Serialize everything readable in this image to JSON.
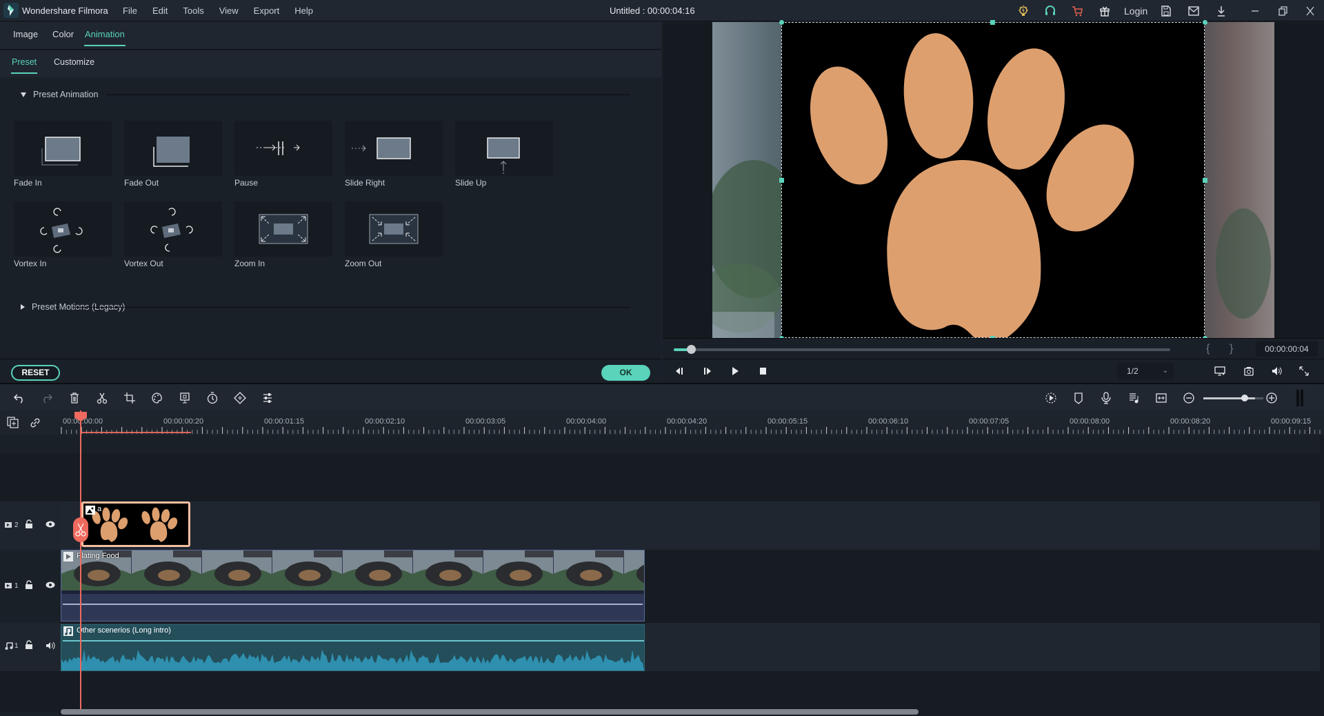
{
  "titlebar": {
    "app_name": "Wondershare Filmora",
    "menu": [
      "File",
      "Edit",
      "Tools",
      "View",
      "Export",
      "Help"
    ],
    "document_title": "Untitled : 00:00:04:16",
    "login_label": "Login",
    "icons": [
      "tips-bulb-icon",
      "support-headset-icon",
      "cart-icon",
      "gift-icon",
      "save-icon",
      "mail-icon",
      "download-icon",
      "minimize-icon",
      "restore-icon",
      "close-icon"
    ]
  },
  "editor": {
    "tabs": [
      "Image",
      "Color",
      "Animation"
    ],
    "active_tab": "Animation",
    "subtabs": [
      "Preset",
      "Customize"
    ],
    "active_subtab": "Preset",
    "section_preset_animation": "Preset Animation",
    "section_preset_motions": "Preset Motions (Legacy)",
    "presets": [
      {
        "label": "Fade In",
        "icon": "fade-in-icon"
      },
      {
        "label": "Fade Out",
        "icon": "fade-out-icon"
      },
      {
        "label": "Pause",
        "icon": "pause-icon"
      },
      {
        "label": "Slide Right",
        "icon": "slide-right-icon"
      },
      {
        "label": "Slide Up",
        "icon": "slide-up-icon"
      },
      {
        "label": "Vortex In",
        "icon": "vortex-in-icon"
      },
      {
        "label": "Vortex Out",
        "icon": "vortex-out-icon"
      },
      {
        "label": "Zoom In",
        "icon": "zoom-in-icon"
      },
      {
        "label": "Zoom Out",
        "icon": "zoom-out-icon"
      }
    ],
    "reset_label": "RESET",
    "ok_label": "OK"
  },
  "preview": {
    "timecode": "00:00:00:04",
    "progress_fraction": 0.035,
    "mark_in": "{",
    "mark_out": "}",
    "quality": "1/2",
    "overlay_colors": {
      "paw": "#dd9f6e",
      "background": "#000000"
    }
  },
  "timeline": {
    "ruler_labels": [
      "00:00:00:00",
      "00:00:00:20",
      "00:00:01:15",
      "00:00:02:10",
      "00:00:03:05",
      "00:00:04:00",
      "00:00:04:20",
      "00:00:05:15",
      "00:00:06:10",
      "00:00:07:05",
      "00:00:08:00",
      "00:00:08:20",
      "00:00:09:15"
    ],
    "tracks": [
      {
        "id": "V2",
        "label": "2",
        "type": "video"
      },
      {
        "id": "V1",
        "label": "1",
        "type": "video"
      },
      {
        "id": "A1",
        "label": "1",
        "type": "audio"
      }
    ],
    "clips": {
      "image_clip_label": "a",
      "video_clip_label": "Plating Food",
      "audio_clip_label": "Other scenerios  (Long intro)"
    },
    "zoom_level_fraction": 0.8,
    "colors": {
      "accent": "#5ad3bb",
      "playhead": "#ef6a5e",
      "video_clip": "#2e3856",
      "audio_clip": "#234e5a",
      "waveform": "#2f8fae",
      "image_clip_border": "#f4bfa0"
    }
  }
}
